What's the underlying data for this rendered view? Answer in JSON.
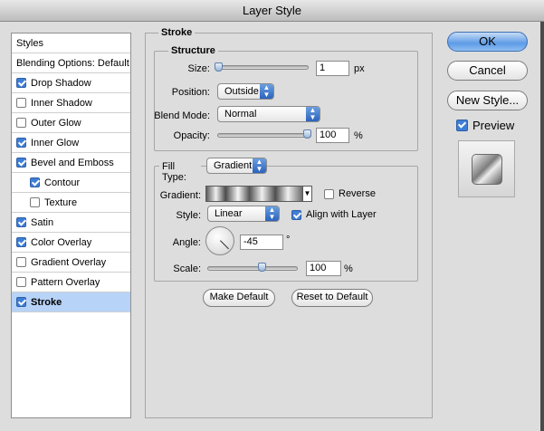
{
  "window": {
    "title": "Layer Style"
  },
  "sidebar": {
    "header": "Styles",
    "items": [
      {
        "label": "Blending Options: Default",
        "checkbox": false,
        "checked": false,
        "indent": false,
        "selected": false
      },
      {
        "label": "Drop Shadow",
        "checkbox": true,
        "checked": true,
        "indent": false,
        "selected": false
      },
      {
        "label": "Inner Shadow",
        "checkbox": true,
        "checked": false,
        "indent": false,
        "selected": false
      },
      {
        "label": "Outer Glow",
        "checkbox": true,
        "checked": false,
        "indent": false,
        "selected": false
      },
      {
        "label": "Inner Glow",
        "checkbox": true,
        "checked": true,
        "indent": false,
        "selected": false
      },
      {
        "label": "Bevel and Emboss",
        "checkbox": true,
        "checked": true,
        "indent": false,
        "selected": false
      },
      {
        "label": "Contour",
        "checkbox": true,
        "checked": true,
        "indent": true,
        "selected": false
      },
      {
        "label": "Texture",
        "checkbox": true,
        "checked": false,
        "indent": true,
        "selected": false
      },
      {
        "label": "Satin",
        "checkbox": true,
        "checked": true,
        "indent": false,
        "selected": false
      },
      {
        "label": "Color Overlay",
        "checkbox": true,
        "checked": true,
        "indent": false,
        "selected": false
      },
      {
        "label": "Gradient Overlay",
        "checkbox": true,
        "checked": false,
        "indent": false,
        "selected": false
      },
      {
        "label": "Pattern Overlay",
        "checkbox": true,
        "checked": false,
        "indent": false,
        "selected": false
      },
      {
        "label": "Stroke",
        "checkbox": true,
        "checked": true,
        "indent": false,
        "selected": true
      }
    ]
  },
  "stroke": {
    "title": "Stroke",
    "structure": {
      "title": "Structure",
      "size_label": "Size:",
      "size_value": "1",
      "size_unit": "px",
      "position_label": "Position:",
      "position_value": "Outside",
      "blend_mode_label": "Blend Mode:",
      "blend_mode_value": "Normal",
      "opacity_label": "Opacity:",
      "opacity_value": "100",
      "opacity_unit": "%",
      "size_slider_fraction": 0.0,
      "opacity_slider_fraction": 1.0
    },
    "fill": {
      "fill_type_label": "Fill Type:",
      "fill_type_value": "Gradient",
      "gradient_label": "Gradient:",
      "reverse_label": "Reverse",
      "reverse_checked": false,
      "style_label": "Style:",
      "style_value": "Linear",
      "align_label": "Align with Layer",
      "align_checked": true,
      "angle_label": "Angle:",
      "angle_value": "-45",
      "angle_unit": "°",
      "scale_label": "Scale:",
      "scale_value": "100",
      "scale_unit": "%",
      "scale_slider_fraction": 0.62
    },
    "make_default_label": "Make Default",
    "reset_default_label": "Reset to Default"
  },
  "buttons": {
    "ok": "OK",
    "cancel": "Cancel",
    "new_style": "New Style...",
    "preview_label": "Preview",
    "preview_checked": true
  },
  "colors": {
    "selection": "#b7d3f7",
    "checkbox_checked": "#3f7ed6",
    "primary_button": "#5d9be6"
  }
}
